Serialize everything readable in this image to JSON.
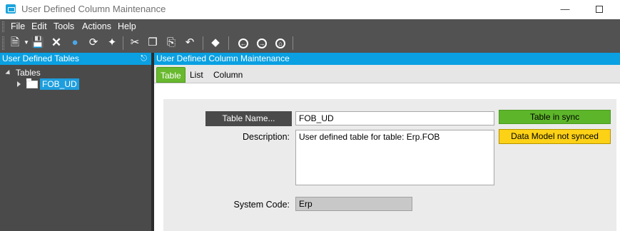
{
  "window": {
    "title": "User Defined Column Maintenance"
  },
  "menu": [
    "File",
    "Edit",
    "Tools",
    "Actions",
    "Help"
  ],
  "toolbar": {
    "icons": [
      "new-icon",
      "save-icon",
      "delete-icon",
      "chat-icon",
      "refresh-icon",
      "clear-icon",
      "cut-icon",
      "copy-icon",
      "paste-icon",
      "undo-icon",
      "search-icon",
      "back-icon",
      "forward-icon",
      "home-icon"
    ]
  },
  "left_panel": {
    "header": "User Defined Tables",
    "tree": {
      "root": "Tables",
      "node": "FOB_UD"
    }
  },
  "right_panel": {
    "header": "User Defined Column Maintenance",
    "tabs": [
      "Table",
      "List",
      "Column"
    ],
    "active_tab": "Table"
  },
  "form": {
    "table_name_button": "Table Name...",
    "table_name_value": "FOB_UD",
    "description_label": "Description:",
    "description_value": "User defined table for table: Erp.FOB",
    "system_code_label": "System Code:",
    "system_code_value": "Erp"
  },
  "status": {
    "sync": "Table in sync",
    "model": "Data Model not synced",
    "sync_color": "#5db62a",
    "model_color": "#fcd116"
  },
  "colors": {
    "accent": "#0aa0e2",
    "tab_active": "#68b92e",
    "panel_dark": "#4a4a4a"
  }
}
